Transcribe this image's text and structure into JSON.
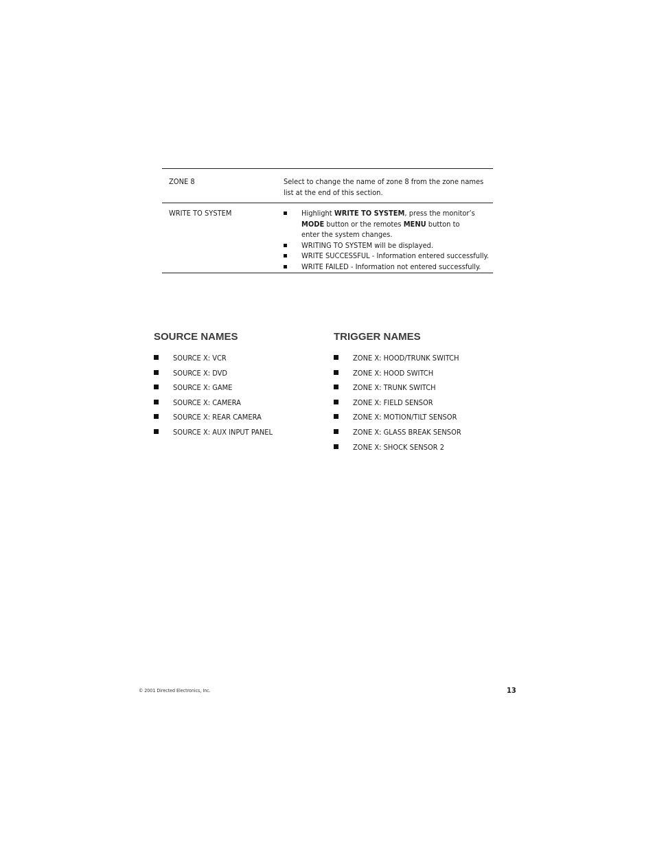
{
  "table": {
    "rows": [
      {
        "label": "ZONE 8",
        "description_lines": [
          "Select to change the name of zone 8 from the zone names",
          "list at the end of this section."
        ]
      },
      {
        "label": "WRITE TO SYSTEM",
        "bullets": [
          {
            "pre": "Highlight ",
            "b1": "WRITE TO SYSTEM",
            "mid1": ", press the monitor’s",
            "b2": "MODE",
            "mid2": " button or the remotes ",
            "b3": "MENU",
            "post": " button to",
            "line3": "enter the system changes."
          },
          {
            "text": "WRITING TO SYSTEM will be displayed."
          },
          {
            "text": "WRITE SUCCESSFUL - Information entered successfully."
          },
          {
            "text": "WRITE FAILED - Information not entered successfully."
          }
        ]
      }
    ]
  },
  "source_names": {
    "heading": "SOURCE NAMES",
    "items": [
      "SOURCE X: VCR",
      "SOURCE X: DVD",
      "SOURCE X: GAME",
      "SOURCE X: CAMERA",
      "SOURCE X: REAR CAMERA",
      "SOURCE X: AUX INPUT PANEL"
    ]
  },
  "trigger_names": {
    "heading": "TRIGGER NAMES",
    "items": [
      "ZONE X: HOOD/TRUNK SWITCH",
      "ZONE X: HOOD SWITCH",
      "ZONE X: TRUNK SWITCH",
      "ZONE X: FIELD SENSOR",
      "ZONE X: MOTION/TILT SENSOR",
      "ZONE X: GLASS BREAK SENSOR",
      "ZONE X: SHOCK SENSOR 2"
    ]
  },
  "footer": {
    "copyright": "© 2001 Directed Electronics, Inc.",
    "page_number": "13"
  }
}
